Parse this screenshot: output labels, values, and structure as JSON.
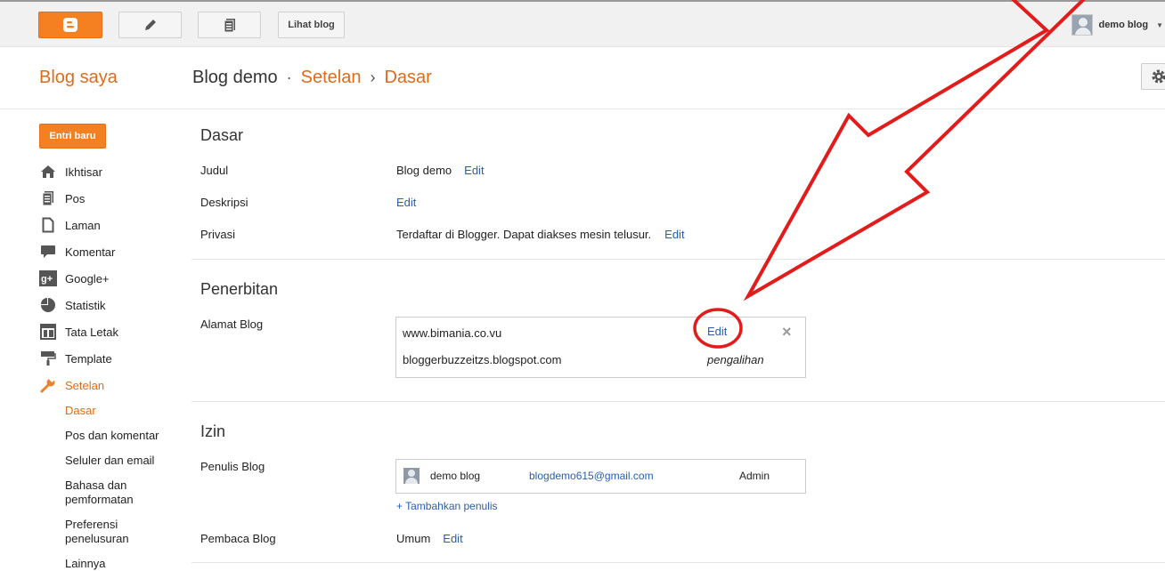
{
  "topbar": {
    "view_blog_label": "Lihat blog",
    "user_name": "demo blog"
  },
  "header": {
    "my_blog": "Blog saya",
    "blog_name": "Blog demo",
    "sep1": "·",
    "crumb1": "Setelan",
    "sep2": "›",
    "crumb2": "Dasar"
  },
  "sidebar": {
    "new_entry": "Entri baru",
    "items": [
      {
        "label": "Ikhtisar",
        "icon": "home-icon"
      },
      {
        "label": "Pos",
        "icon": "posts-icon"
      },
      {
        "label": "Laman",
        "icon": "page-icon"
      },
      {
        "label": "Komentar",
        "icon": "comment-icon"
      },
      {
        "label": "Google+",
        "icon": "google-plus-icon"
      },
      {
        "label": "Statistik",
        "icon": "pie-chart-icon"
      },
      {
        "label": "Tata Letak",
        "icon": "layout-icon"
      },
      {
        "label": "Template",
        "icon": "paint-roller-icon"
      },
      {
        "label": "Setelan",
        "icon": "wrench-icon"
      }
    ],
    "subitems": [
      "Dasar",
      "Pos dan komentar",
      "Seluler dan email",
      "Bahasa dan pemformatan",
      "Preferensi penelusuran",
      "Lainnya"
    ]
  },
  "basic": {
    "title": "Dasar",
    "title_label": "Judul",
    "title_value": "Blog demo",
    "desc_label": "Deskripsi",
    "privacy_label": "Privasi",
    "privacy_value": "Terdaftar di Blogger. Dapat diakses mesin telusur.",
    "edit": "Edit"
  },
  "publishing": {
    "title": "Penerbitan",
    "address_label": "Alamat Blog",
    "custom_domain": "www.bimania.co.vu",
    "blogspot_domain": "bloggerbuzzeitzs.blogspot.com",
    "redirect": "pengalihan",
    "edit": "Edit"
  },
  "permissions": {
    "title": "Izin",
    "authors_label": "Penulis Blog",
    "author_name": "demo blog",
    "author_email": "blogdemo615@gmail.com",
    "author_role": "Admin",
    "add_author": "+ Tambahkan penulis",
    "readers_label": "Pembaca Blog",
    "readers_value": "Umum",
    "edit": "Edit"
  },
  "colors": {
    "accent": "#dd6b17",
    "link": "#2a5db0",
    "annotation": "#e31b1b"
  }
}
